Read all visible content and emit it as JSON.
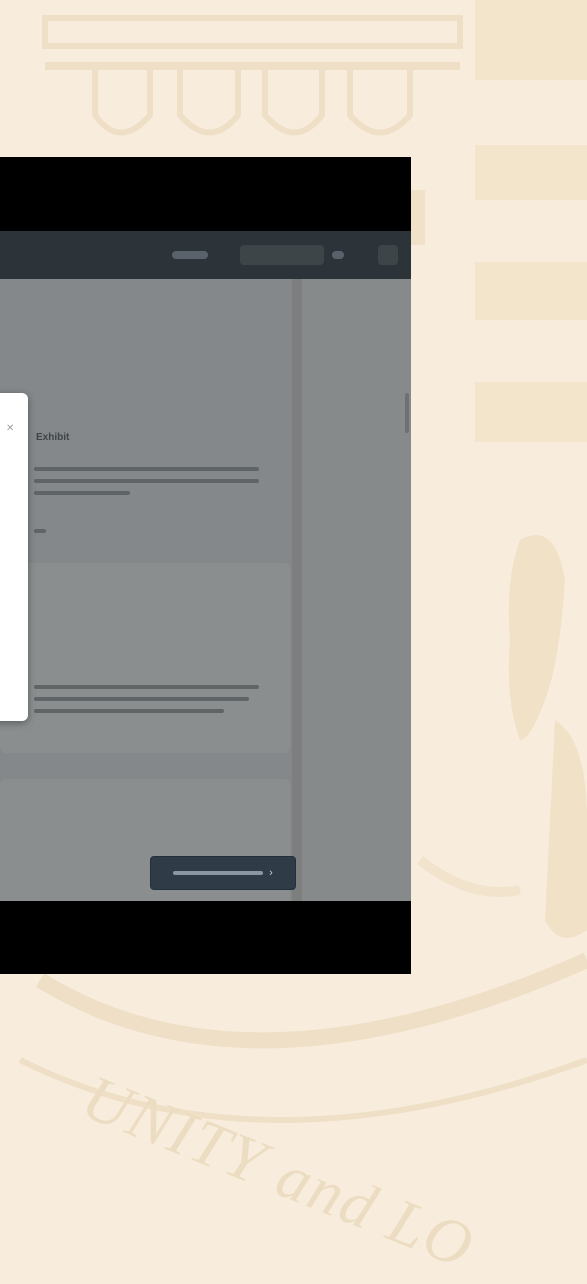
{
  "seal": {
    "motto": "UNITY and LO"
  },
  "screen": {
    "card_title": "Exhibit",
    "dialog_close_icon": "close-icon"
  },
  "colors": {
    "page_bg": "#f8eddd",
    "video_bg": "#000000",
    "screen_overlay": "#7c7f7e",
    "topbar": "#2d3439",
    "button": "#2f3b47",
    "dialog": "#ffffff"
  }
}
